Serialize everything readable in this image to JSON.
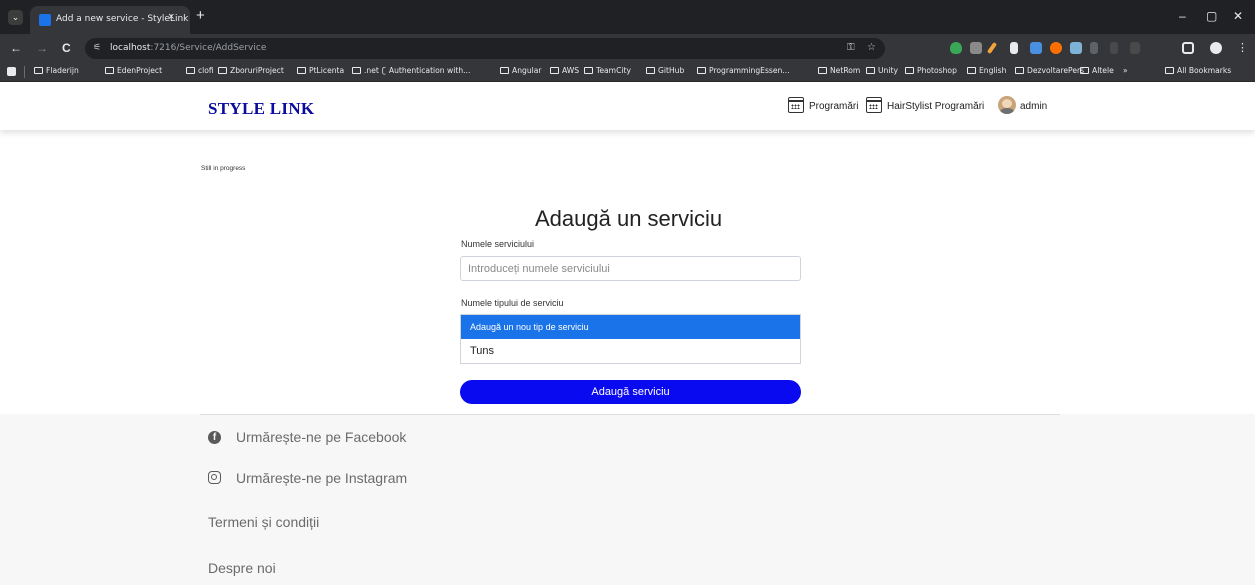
{
  "browser": {
    "tab_title": "Add a new service - StyleLink",
    "tab_close": "×",
    "new_tab": "+",
    "tab_menu": "⌄",
    "url_host": "localhost",
    "url_path": ":7216/Service/AddService",
    "win_minimize": "–",
    "win_restore": "▢",
    "win_close": "✕",
    "nav_back": "←",
    "nav_forward": "→",
    "nav_reload": "C",
    "bookmarks": [
      "Fladerijn",
      "EdenProject",
      "clofi",
      "ZboruriProject",
      "PtLicenta",
      ".net",
      "Authentication with...",
      "Angular",
      "AWS",
      "TeamCity",
      "GitHub",
      "ProgrammingEssen...",
      "NetRom",
      "Unity",
      "Photoshop",
      "English",
      "DezvoltarePers",
      "Altele"
    ],
    "bookmarks_more": "»",
    "all_bookmarks": "All Bookmarks"
  },
  "navbar": {
    "brand": "STYLE LINK",
    "links": [
      "Programări",
      "HairStylist Programări"
    ],
    "user": "admin"
  },
  "main": {
    "progress_note": "Still in progress",
    "title": "Adaugă un serviciu",
    "service_name_label": "Numele serviciului",
    "service_name_placeholder": "Introduceți numele serviciului",
    "service_type_label": "Numele tipului de serviciu",
    "service_type_options": [
      "Adaugă un nou tip de serviciu",
      "Tuns"
    ],
    "selected_option": "Adaugă un nou tip de serviciu",
    "submit_label": "Adaugă serviciu"
  },
  "footer": {
    "facebook": "Urmărește-ne pe Facebook",
    "instagram": "Urmărește-ne pe Instagram",
    "terms": "Termeni și condiții",
    "about": "Despre noi"
  },
  "colors": {
    "brand": "#0b0b9e",
    "primary_button": "#0a0af0",
    "selected_option": "#1a73e8"
  }
}
